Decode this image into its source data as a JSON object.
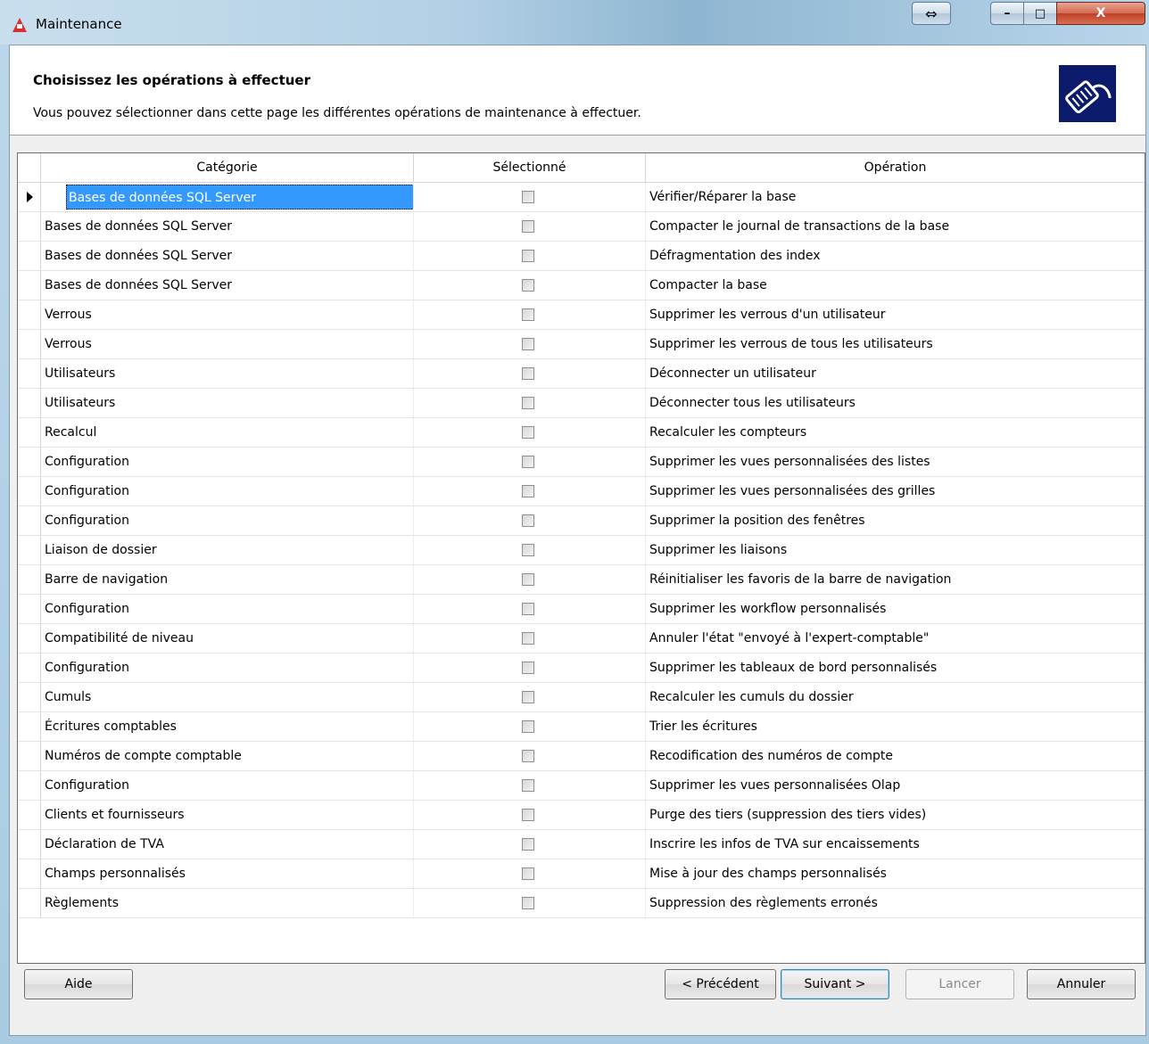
{
  "window": {
    "title": "Maintenance",
    "controls": {
      "resize": "⇔",
      "minimize": "–",
      "maximize": "□",
      "close": "X"
    }
  },
  "header": {
    "title": "Choisissez les opérations à effectuer",
    "subtitle": "Vous pouvez sélectionner dans cette page les différentes opérations de maintenance à effectuer."
  },
  "grid": {
    "columns": [
      "Catégorie",
      "Sélectionné",
      "Opération"
    ],
    "rows": [
      {
        "category": "Bases de données SQL Server",
        "selected": false,
        "operation": "Vérifier/Réparer la base"
      },
      {
        "category": "Bases de données SQL Server",
        "selected": false,
        "operation": "Compacter le journal de transactions de la base"
      },
      {
        "category": "Bases de données SQL Server",
        "selected": false,
        "operation": "Défragmentation des index"
      },
      {
        "category": "Bases de données SQL Server",
        "selected": false,
        "operation": "Compacter la base"
      },
      {
        "category": "Verrous",
        "selected": false,
        "operation": "Supprimer les verrous d'un utilisateur"
      },
      {
        "category": "Verrous",
        "selected": false,
        "operation": "Supprimer les verrous de tous les utilisateurs"
      },
      {
        "category": "Utilisateurs",
        "selected": false,
        "operation": "Déconnecter un utilisateur"
      },
      {
        "category": "Utilisateurs",
        "selected": false,
        "operation": "Déconnecter tous les utilisateurs"
      },
      {
        "category": "Recalcul",
        "selected": false,
        "operation": "Recalculer les compteurs"
      },
      {
        "category": "Configuration",
        "selected": false,
        "operation": "Supprimer les vues personnalisées des listes"
      },
      {
        "category": "Configuration",
        "selected": false,
        "operation": "Supprimer les vues personnalisées des grilles"
      },
      {
        "category": "Configuration",
        "selected": false,
        "operation": "Supprimer la position des fenêtres"
      },
      {
        "category": "Liaison de dossier",
        "selected": false,
        "operation": "Supprimer les liaisons"
      },
      {
        "category": "Barre de navigation",
        "selected": false,
        "operation": "Réinitialiser les favoris de la barre de navigation"
      },
      {
        "category": "Configuration",
        "selected": false,
        "operation": "Supprimer les workflow personnalisés"
      },
      {
        "category": "Compatibilité de niveau",
        "selected": false,
        "operation": "Annuler l'état \"envoyé à l'expert-comptable\""
      },
      {
        "category": "Configuration",
        "selected": false,
        "operation": "Supprimer les tableaux de bord personnalisés"
      },
      {
        "category": "Cumuls",
        "selected": false,
        "operation": "Recalculer les cumuls du dossier"
      },
      {
        "category": "Écritures comptables",
        "selected": false,
        "operation": "Trier les écritures"
      },
      {
        "category": "Numéros de compte comptable",
        "selected": false,
        "operation": "Recodification des numéros de compte"
      },
      {
        "category": "Configuration",
        "selected": false,
        "operation": "Supprimer les vues personnalisées Olap"
      },
      {
        "category": "Clients et fournisseurs",
        "selected": false,
        "operation": "Purge des tiers (suppression des tiers vides)"
      },
      {
        "category": "Déclaration de TVA",
        "selected": false,
        "operation": "Inscrire les infos de TVA sur encaissements"
      },
      {
        "category": "Champs personnalisés",
        "selected": false,
        "operation": "Mise à jour des champs personnalisés"
      },
      {
        "category": "Règlements",
        "selected": false,
        "operation": "Suppression des règlements erronés"
      }
    ]
  },
  "buttons": {
    "help": "Aide",
    "previous": "< Précédent",
    "next": "Suivant >",
    "launch": "Lancer",
    "cancel": "Annuler"
  },
  "colors": {
    "selection": "#3399ff",
    "header_icon_bg": "#0b1a6b"
  }
}
